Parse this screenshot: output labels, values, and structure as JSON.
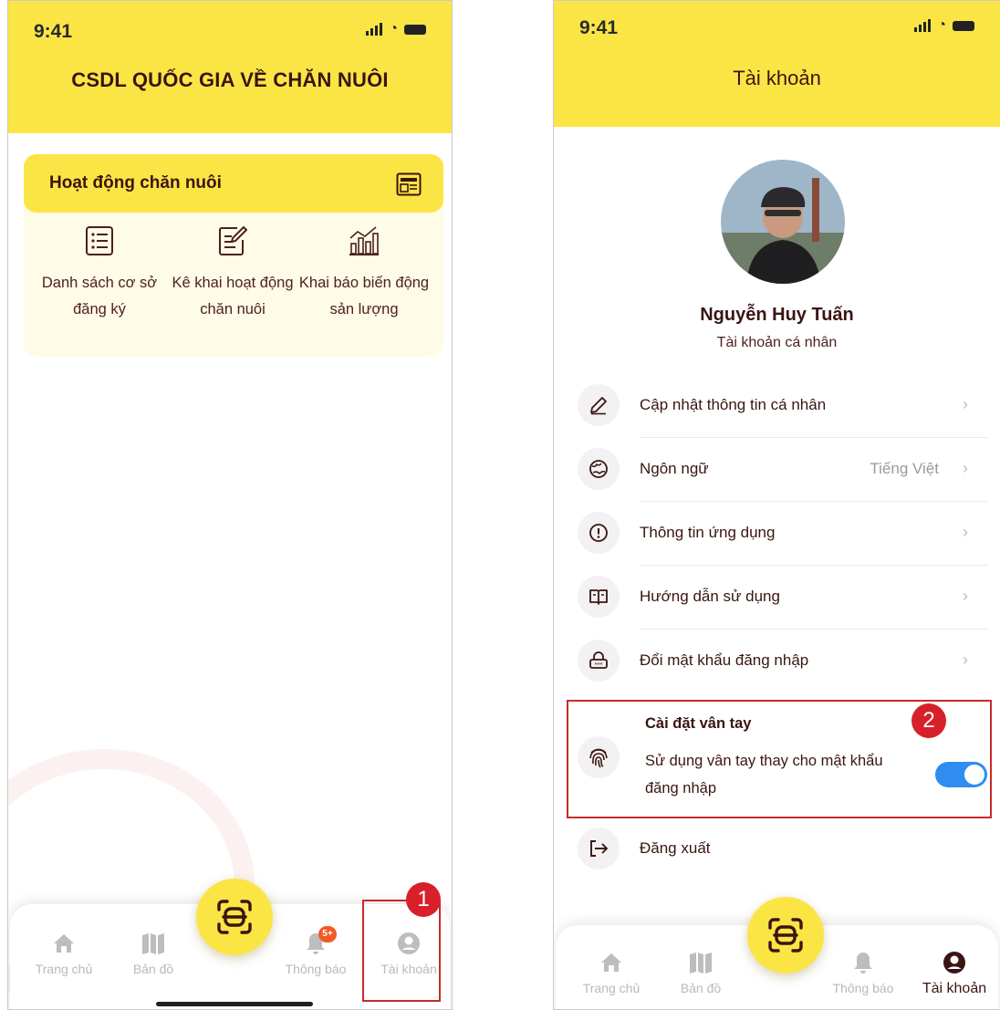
{
  "left_screen": {
    "status_time": "9:41",
    "header_title": "CSDL QUỐC GIA VỀ CHĂN NUÔI",
    "card_title": "Hoạt động chăn nuôi",
    "items": [
      {
        "label": "Danh sách cơ sở đăng ký",
        "icon": "list-icon"
      },
      {
        "label": "Kê khai hoạt động chăn nuôi",
        "icon": "edit-document-icon"
      },
      {
        "label": "Khai báo biến động sản lượng",
        "icon": "bar-chart-icon"
      }
    ],
    "nav": {
      "home": "Trang chủ",
      "map": "Bản đồ",
      "notifications": "Thông báo",
      "notifications_badge": "5+",
      "account": "Tài khoản"
    },
    "step_number": "1"
  },
  "right_screen": {
    "status_time": "9:41",
    "header_title": "Tài khoản",
    "user_name": "Nguyễn Huy Tuấn",
    "account_type": "Tài khoản cá nhân",
    "menu": {
      "update_info": "Cập nhật thông tin cá nhân",
      "language": "Ngôn ngữ",
      "language_value": "Tiếng Việt",
      "app_info": "Thông tin ứng dụng",
      "user_guide": "Hướng dẫn sử dụng",
      "change_password": "Đổi mật khẩu đăng nhập",
      "logout": "Đăng xuất",
      "chevron": "›"
    },
    "fingerprint": {
      "title": "Cài đặt vân tay",
      "description": "Sử dụng vân tay thay cho mật khẩu đăng nhập",
      "enabled": true
    },
    "nav": {
      "home": "Trang chủ",
      "map": "Bản đồ",
      "notifications": "Thông báo",
      "account": "Tài khoản"
    },
    "step_number": "2"
  },
  "colors": {
    "header_yellow": "#fbe545",
    "text_dark": "#3a1512",
    "annotation_red": "#c82a2a",
    "toggle_blue": "#2f8df2",
    "nav_inactive": "#b9b9b9"
  }
}
